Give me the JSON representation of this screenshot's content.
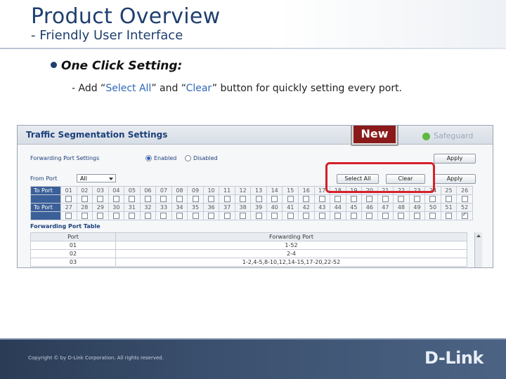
{
  "slide": {
    "title": "Product Overview",
    "subtitle": "- Friendly User Interface",
    "bullet": "One Click Setting:",
    "desc_prefix": "- Add “",
    "desc_select_all": "Select All",
    "desc_mid": "” and “",
    "desc_clear": "Clear",
    "desc_suffix": "” button for quickly setting every port."
  },
  "screenshot": {
    "panel_title": "Traffic Segmentation Settings",
    "new_badge": "New",
    "safeguard": "Safeguard",
    "forwarding_port_settings_label": "Forwarding Port Settings",
    "enabled_label": "Enabled",
    "disabled_label": "Disabled",
    "apply_label": "Apply",
    "from_port_label": "From Port",
    "from_port_value": "All",
    "select_all_label": "Select All",
    "clear_label": "Clear",
    "apply2_label": "Apply",
    "to_port_label": "To Port",
    "ports_row1": [
      "01",
      "02",
      "03",
      "04",
      "05",
      "06",
      "07",
      "08",
      "09",
      "10",
      "11",
      "12",
      "13",
      "14",
      "15",
      "16",
      "17",
      "18",
      "19",
      "20",
      "21",
      "22",
      "23",
      "24",
      "25",
      "26"
    ],
    "ports_row2": [
      "27",
      "28",
      "29",
      "30",
      "31",
      "32",
      "33",
      "34",
      "35",
      "36",
      "37",
      "38",
      "39",
      "40",
      "41",
      "42",
      "43",
      "44",
      "45",
      "46",
      "47",
      "48",
      "49",
      "50",
      "51",
      "52"
    ],
    "forwarding_port_table_label": "Forwarding Port Table",
    "table_head_port": "Port",
    "table_head_forwarding": "Forwarding Port",
    "table_rows": [
      {
        "port": "01",
        "forwarding": "1-52"
      },
      {
        "port": "02",
        "forwarding": "2-4"
      },
      {
        "port": "03",
        "forwarding": "1-2,4-5,8-10,12,14-15,17-20,22-52"
      }
    ]
  },
  "footer": {
    "copyright": "Copyright © by D-Link Corporation. All rights reserved.",
    "logo": "D-Link"
  }
}
